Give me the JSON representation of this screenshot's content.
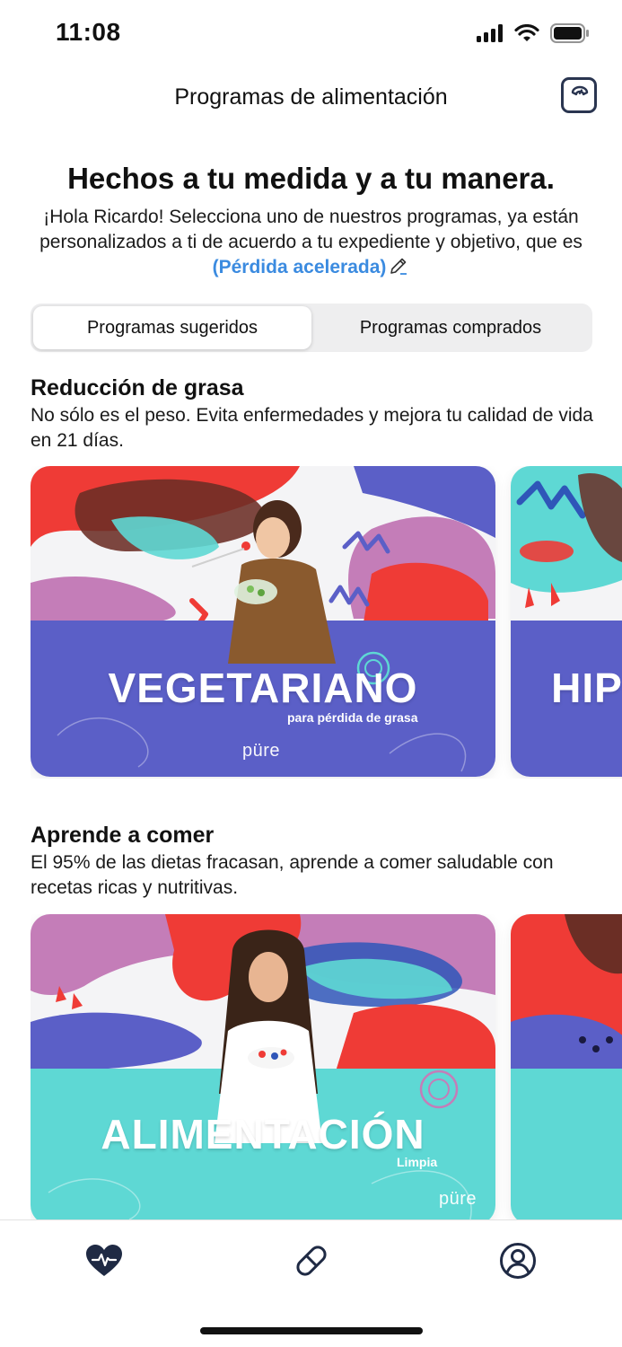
{
  "status_bar": {
    "time": "11:08"
  },
  "nav": {
    "title": "Programas de alimentación"
  },
  "header": {
    "headline": "Hechos a tu medida y a tu manera.",
    "intro": "¡Hola Ricardo! Selecciona uno de nuestros programas, ya están personalizados a ti de acuerdo a tu expediente y objetivo, que es",
    "goal": "(Pérdida acelerada)"
  },
  "segmented": {
    "tabs": [
      {
        "label": "Programas sugeridos",
        "selected": true
      },
      {
        "label": "Programas comprados",
        "selected": false
      }
    ]
  },
  "sections": [
    {
      "title": "Reducción de grasa",
      "description": "No sólo es el peso. Evita enfermedades y mejora tu calidad de vida en 21 días.",
      "cards": [
        {
          "title": "VEGETARIANO",
          "subtitle": "para pérdida de grasa",
          "brand": "püre"
        },
        {
          "title": "HIP"
        }
      ]
    },
    {
      "title": "Aprende a comer",
      "description": "El 95% de las dietas fracasan, aprende a comer saludable con recetas ricas y nutritivas.",
      "cards": [
        {
          "title": "ALIMENTACIÓN",
          "subtitle": "Limpia",
          "brand": "püre"
        }
      ]
    }
  ],
  "tab_bar": {
    "icons": [
      "heart-pulse-icon",
      "pill-icon",
      "profile-icon"
    ]
  },
  "colors": {
    "accent": "#3b8be0",
    "navy": "#2a3550",
    "purple": "#5b5fc7",
    "teal": "#5ed8d4",
    "red": "#ef3b36",
    "pink": "#c47db8"
  }
}
